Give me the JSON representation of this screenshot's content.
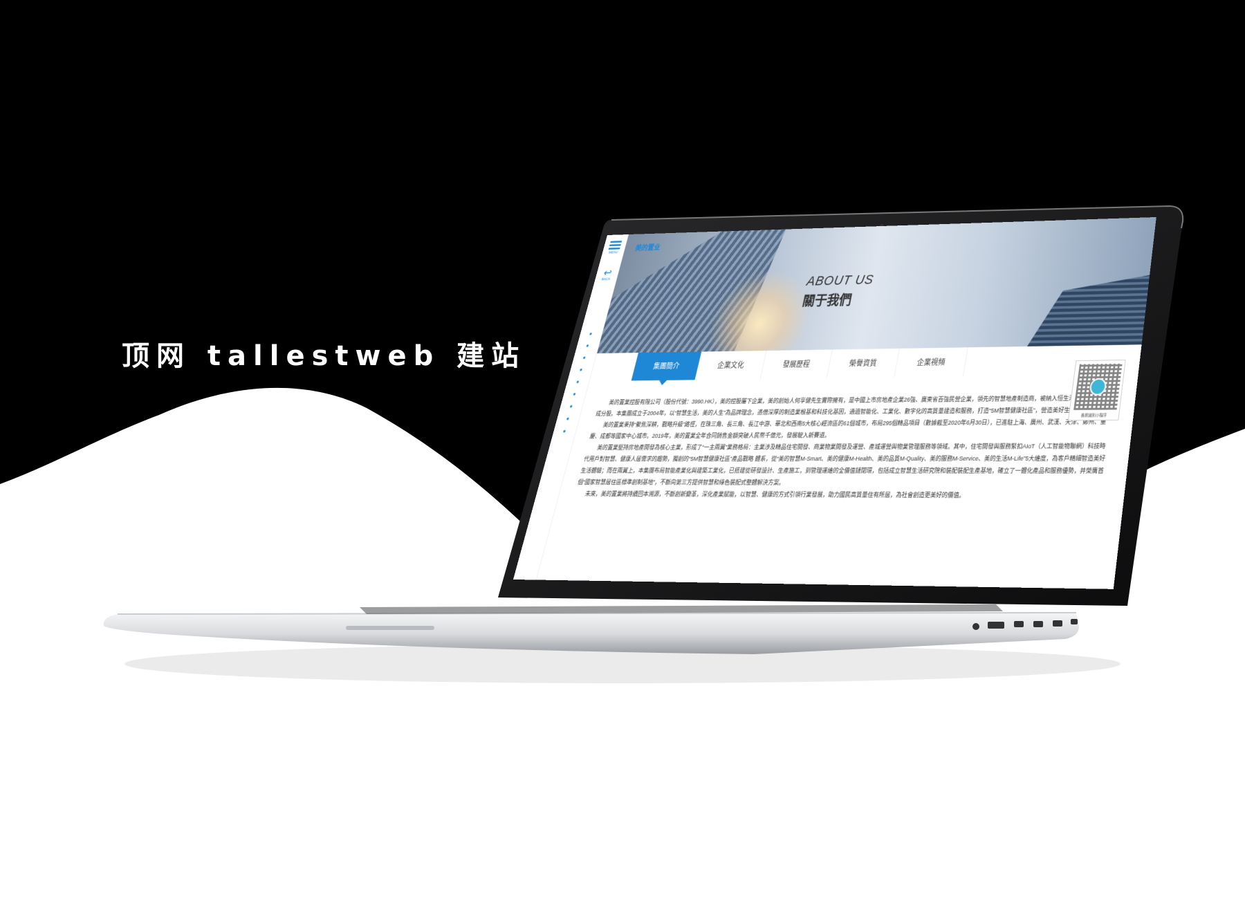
{
  "brand": {
    "text": "顶网 tallestweb 建站"
  },
  "site": {
    "logo": "美的置业",
    "menu_label": "MENU",
    "back_label": "BACK",
    "hero": {
      "title_en": "ABOUT US",
      "title_zh": "關于我們"
    },
    "tabs": [
      {
        "label": "集團簡介",
        "active": true
      },
      {
        "label": "企業文化",
        "active": false
      },
      {
        "label": "發展歷程",
        "active": false
      },
      {
        "label": "榮譽資質",
        "active": false
      },
      {
        "label": "企業視頻",
        "active": false
      }
    ],
    "paragraphs": [
      "美的置業控股有限公司（股份代號：3990.HK），美的控股屬下企業，美的創始人何享健先生實際擁有，是中國上市房地產企業26強、廣東省百強民營企業，領先的智慧地產制造商，被納入恒生港股通等7大指數成分股。本集團成立于2004年，以“智慧生活，美的人生”為品牌理念，憑借深厚的制造業根基和科技化基因，通過智能化、工業化、數字化的高質量建造和服務，打造“5M智慧健康社區”，營造美好生活方式。",
      "美的置業秉持“聚焦深耕，戰略升級”路徑，在珠三角、長三角、長江中游、華北和西南5大核心經濟區的61個城市，布局295個精品項目（數據截至2020年6月30日），已進駐上海、廣州、武漢、天津、鄭州、重慶、成都等國家中心城市。2019年，美的置業全年合同銷售金額突破人民幣千億元，發展駛入新賽道。",
      "美的置業堅持房地產開發為核心主業，形成了“一主兩翼”業務格局：主業涉及精品住宅開發、商業物業開發及運營、產城運營與物業管理服務等領域。其中，住宅開發與服務緊扣AIoT（人工智能物聯網）科技時代用戶對智慧、健康人居需求的趨勢，獨創的“5M智慧健康社區”產品戰略 體系，從“美的智慧M-Smart、美的健康M-Health、美的品質M-Quality、美的服務M-Service、美的生活M-Life”5大維度，為客戶精細智造美好生活體驗；而在兩翼上，本集團布局智能產業化與建築工業化，已搭建從研發設計、生產施工，到管理運維的全價值鏈閉環，包括成立智慧生活研究院和裝配裝配生產基地，確立了一體化產品和服務優勢，并榮膺首個“國家智慧居住區標準創制基地”，不斷向第三方提供智慧和綠色裝配式整體解決方案。",
      "未來，美的置業將持續回本溯源，不斷創新變革，深化產業賦能，以智慧、健康的方式引領行業發展，助力國民高質量住有所居，為社會創造更美好的價值。"
    ],
    "qr_caption": "長按識別小程序"
  }
}
